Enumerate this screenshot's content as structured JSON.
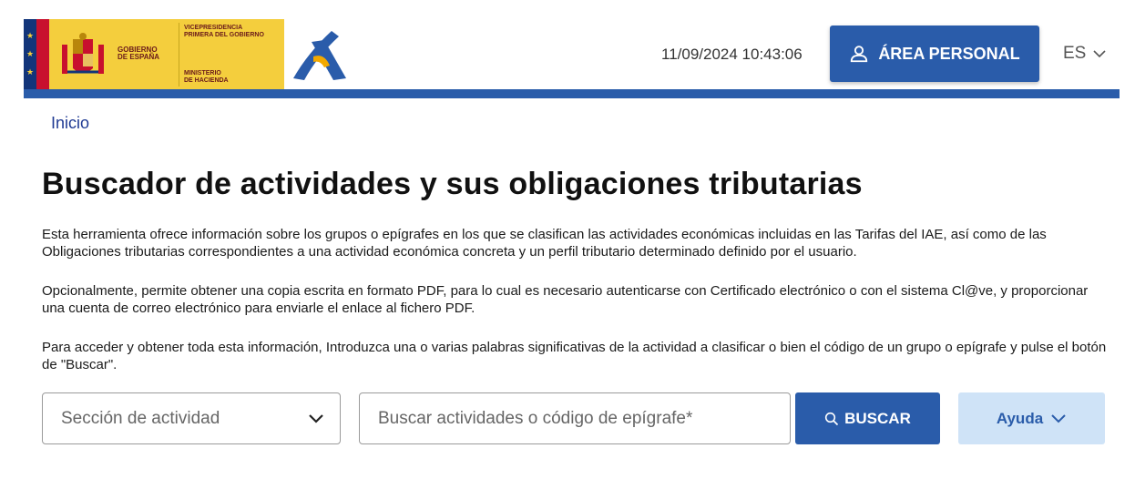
{
  "header": {
    "gov_line1": "GOBIERNO",
    "gov_line2": "DE ESPAÑA",
    "vice_line1": "VICEPRESIDENCIA",
    "vice_line2": "PRIMERA DEL GOBIERNO",
    "min_line1": "MINISTERIO",
    "min_line2": "DE HACIENDA",
    "datetime": "11/09/2024 10:43:06",
    "area_personal_label": "ÁREA PERSONAL",
    "language": "ES"
  },
  "breadcrumb": {
    "home": "Inicio"
  },
  "main": {
    "title": "Buscador de actividades y sus obligaciones tributarias",
    "paragraph1": "Esta herramienta ofrece información sobre los grupos o epígrafes en los que se clasifican las actividades económicas incluidas en las Tarifas del IAE, así como de las Obligaciones tributarias correspondientes a una actividad económica concreta y un perfil tributario determinado definido por el usuario.",
    "paragraph2": "Opcionalmente, permite obtener una copia escrita en formato PDF, para lo cual es necesario autenticarse con Certificado electrónico o con el sistema Cl@ve, y proporcionar una cuenta de correo electrónico para enviarle el enlace al fichero PDF.",
    "paragraph3": "Para acceder y obtener toda esta información, Introduzca una o varias palabras significativas de la actividad a clasificar o bien el código de un grupo o epígrafe y pulse el botón de \"Buscar\"."
  },
  "search": {
    "section_select_label": "Sección de actividad",
    "input_placeholder": "Buscar actividades o código de epígrafe*",
    "buscar_label": "BUSCAR",
    "ayuda_label": "Ayuda"
  },
  "colors": {
    "primary": "#2a5caa",
    "gov_yellow": "#f4ce3d",
    "ayuda_bg": "#cfe3f7"
  },
  "icons": [
    "user-icon",
    "chevron-down-icon",
    "search-icon",
    "coat-of-arms-icon",
    "aeat-logo-icon"
  ]
}
